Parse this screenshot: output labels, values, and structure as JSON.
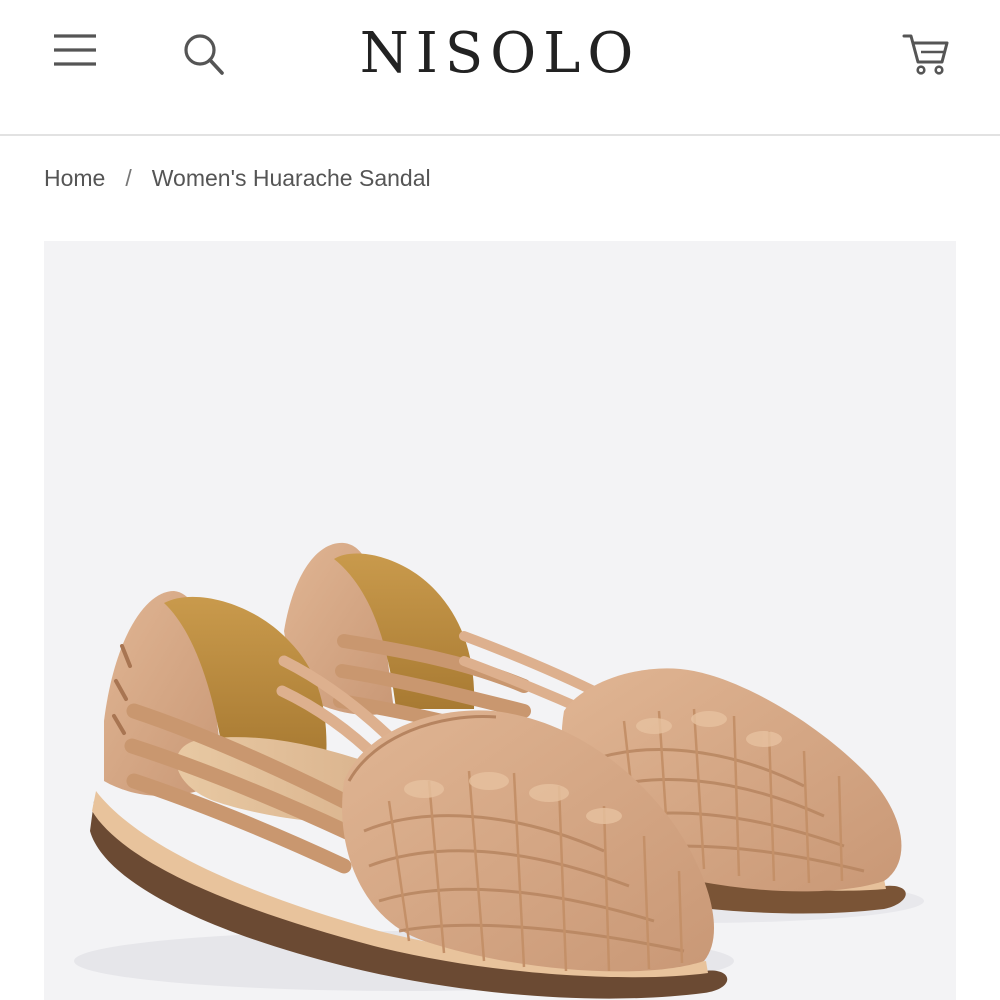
{
  "header": {
    "logo": "NISOLO",
    "icons": {
      "menu": "hamburger-menu-icon",
      "search": "search-icon",
      "cart": "shopping-cart-icon"
    }
  },
  "breadcrumb": {
    "home": "Home",
    "separator": "/",
    "current": "Women's Huarache Sandal"
  },
  "product": {
    "image": "tan woven leather huarache sandals pair",
    "image_background": "#f3f3f5",
    "leather_color": "#d4a482",
    "sole_color": "#6b4a33"
  },
  "colors": {
    "text": "#222222",
    "muted": "#555555",
    "divider": "#e2e2e2"
  }
}
